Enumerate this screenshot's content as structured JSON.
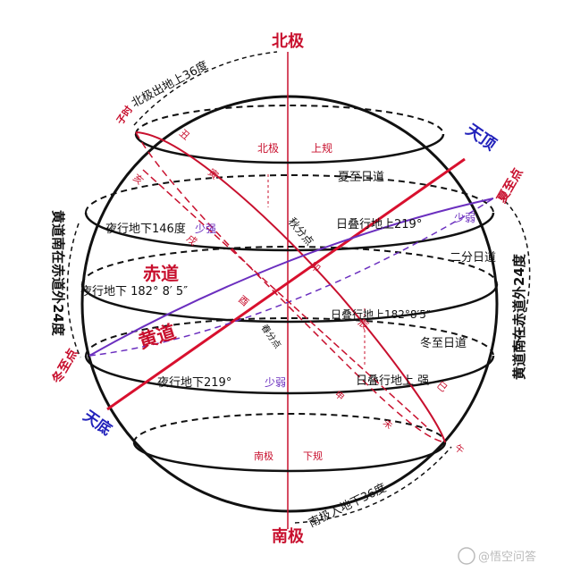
{
  "poles": {
    "north": "北极",
    "south": "南极"
  },
  "zenith": "天顶",
  "nadir": "天底",
  "north_pole_above": "北极出地上36度",
  "south_pole_below": "南极入地下36度",
  "ecliptic_south": "黄道南在赤道外24度",
  "ecliptic_north": "黄道南在赤道外24度",
  "upper_circle": {
    "north_pole": "北极",
    "label": "上规"
  },
  "lower_circle": {
    "south_pole": "南极",
    "label": "下规"
  },
  "summer_path": "夏至日道",
  "equinox_path": "二分日道",
  "winter_path": "冬至日道",
  "equator_label": "赤道",
  "ecliptic_label": "黄道",
  "summer_solstice_point": "夏至点",
  "winter_solstice_point": "冬至点",
  "autumn_equinox": "秋分点",
  "spring_equinox": "春分点",
  "summer_night": "夜行地下146度",
  "summer_night_extra": "少强",
  "summer_day": "日叠行地上219°",
  "summer_day_extra": "少弱",
  "equinox_night": "夜行地下 182° 8′ 5″",
  "equinox_day": "日叠行地上182°8′5″",
  "winter_night": "夜行地下219°",
  "winter_night_extra": "少弱",
  "winter_day": "日叠行地上 强",
  "hours": {
    "zi": "子时",
    "chou": "丑",
    "yin": "寅",
    "hai": "亥",
    "xu": "戌",
    "you": "酉",
    "mao": "卯",
    "chen": "辰",
    "si": "巳",
    "shen": "申",
    "wei": "未",
    "wu": "午"
  },
  "watermark": "@悟空问答"
}
